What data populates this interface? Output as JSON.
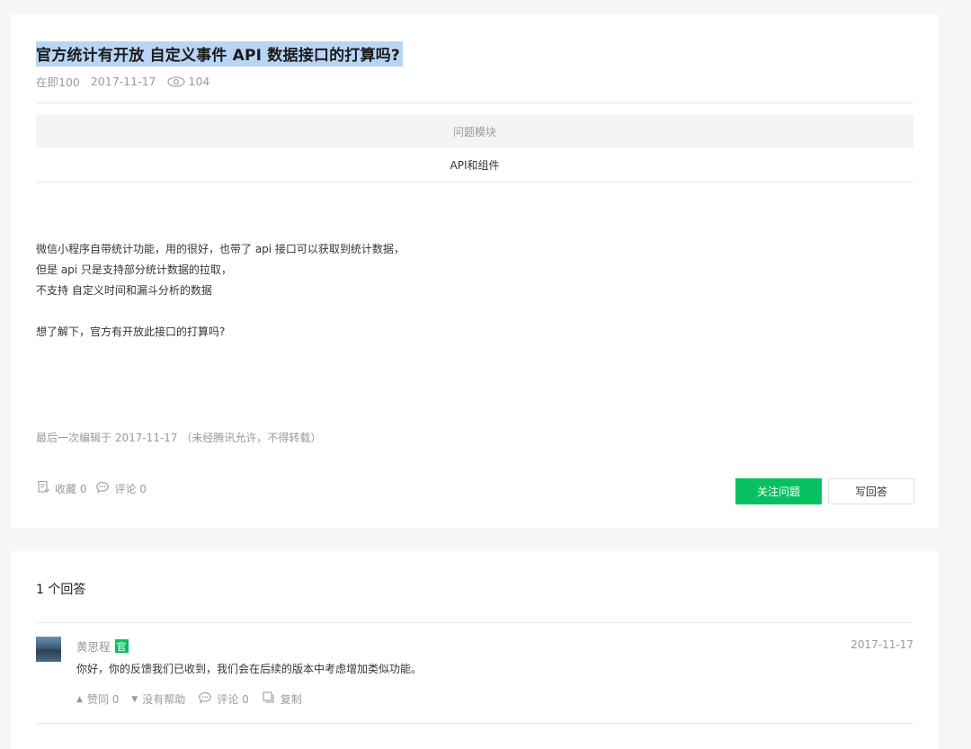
{
  "question": {
    "title": "官方统计有开放 自定义事件 API 数据接口的打算吗?",
    "author": "在即100",
    "date": "2017-11-17",
    "views": "104",
    "module_header": "问题模块",
    "module_value": "API和组件",
    "body_lines": [
      "微信小程序自带统计功能，用的很好，也带了 api 接口可以获取到统计数据，",
      "但是 api 只是支持部分统计数据的拉取，",
      "不支持 自定义时间和漏斗分析的数据",
      "",
      "想了解下，官方有开放此接口的打算吗?"
    ],
    "edited_note": "最后一次编辑于  2017-11-17  （未经腾讯允许，不得转载）",
    "favorite_label": "收藏 0",
    "comment_label": "评论 0",
    "follow_button": "关注问题",
    "write_answer_button": "写回答"
  },
  "answers": {
    "count_label": "1 个回答",
    "items": [
      {
        "name": "黄思程",
        "badge": "官",
        "date": "2017-11-17",
        "text": "你好，你的反馈我们已收到，我们会在后续的版本中考虑增加类似功能。",
        "like_label": "赞同 0",
        "unhelpful_label": "没有帮助",
        "comment_label": "评论 0",
        "copy_label": "复制"
      }
    ]
  },
  "colors": {
    "accent": "#07c160",
    "title_highlight": "#b9d5f5",
    "muted_text": "#9a9a9a"
  }
}
